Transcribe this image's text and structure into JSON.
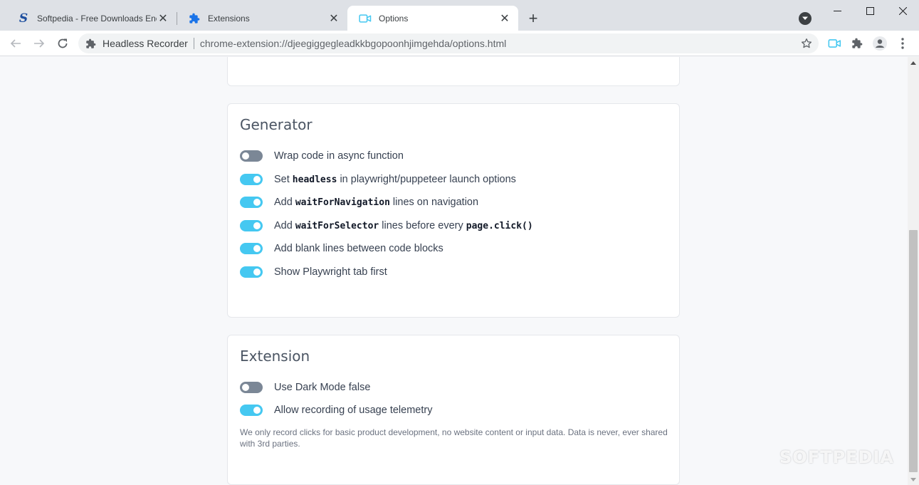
{
  "browser": {
    "tabs": [
      {
        "title": "Softpedia - Free Downloads Encyclopedia",
        "icon": "softpedia-logo",
        "active": false
      },
      {
        "title": "Extensions",
        "icon": "puzzle-icon",
        "active": false
      },
      {
        "title": "Options",
        "icon": "video-camera-icon",
        "active": true
      }
    ],
    "new_tab_label": "+",
    "address_bar": {
      "site_name": "Headless Recorder",
      "url": "chrome-extension://djeegiggegleadkkbgopoonhjimgehda/options.html"
    },
    "accent_color": "#45c8f1"
  },
  "generator": {
    "title": "Generator",
    "options": [
      {
        "enabled": false,
        "parts": [
          {
            "text": "Wrap code in async function",
            "code": false
          }
        ]
      },
      {
        "enabled": true,
        "parts": [
          {
            "text": "Set ",
            "code": false
          },
          {
            "text": "headless",
            "code": true
          },
          {
            "text": " in playwright/puppeteer launch options",
            "code": false
          }
        ]
      },
      {
        "enabled": true,
        "parts": [
          {
            "text": "Add ",
            "code": false
          },
          {
            "text": "waitForNavigation",
            "code": true
          },
          {
            "text": " lines on navigation",
            "code": false
          }
        ]
      },
      {
        "enabled": true,
        "parts": [
          {
            "text": "Add ",
            "code": false
          },
          {
            "text": "waitForSelector",
            "code": true
          },
          {
            "text": " lines before every ",
            "code": false
          },
          {
            "text": "page.click()",
            "code": true
          }
        ]
      },
      {
        "enabled": true,
        "parts": [
          {
            "text": "Add blank lines between code blocks",
            "code": false
          }
        ]
      },
      {
        "enabled": true,
        "parts": [
          {
            "text": "Show Playwright tab first",
            "code": false
          }
        ]
      }
    ]
  },
  "extension": {
    "title": "Extension",
    "options": [
      {
        "enabled": false,
        "parts": [
          {
            "text": "Use Dark Mode false",
            "code": false
          }
        ]
      },
      {
        "enabled": true,
        "parts": [
          {
            "text": "Allow recording of usage telemetry",
            "code": false
          }
        ]
      }
    ],
    "note": "We only record clicks for basic product development, no website content or input data. Data is never, ever shared with 3rd parties."
  },
  "watermark": "SOFTPEDIA"
}
